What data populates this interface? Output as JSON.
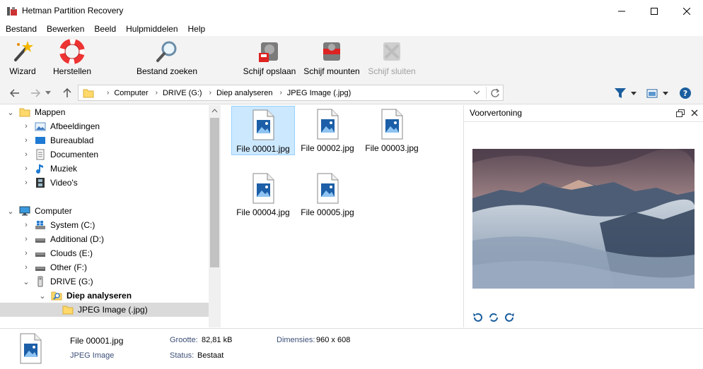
{
  "window": {
    "title": "Hetman Partition Recovery",
    "minimize_icon": "minimize-icon",
    "maximize_icon": "maximize-icon",
    "close_icon": "close-icon"
  },
  "menu": [
    "Bestand",
    "Bewerken",
    "Beeld",
    "Hulpmiddelen",
    "Help"
  ],
  "toolbar": {
    "wizard": "Wizard",
    "restore": "Herstellen",
    "find_file": "Bestand zoeken",
    "save_disk": "Schijf opslaan",
    "mount_disk": "Schijf mounten",
    "close_disk": "Schijf sluiten"
  },
  "address": {
    "crumbs": [
      "Computer",
      "DRIVE (G:)",
      "Diep analyseren",
      "JPEG Image (.jpg)"
    ]
  },
  "tree": {
    "folders_label": "Mappen",
    "folders": [
      "Afbeeldingen",
      "Bureaublad",
      "Documenten",
      "Muziek",
      "Video's"
    ],
    "computer_label": "Computer",
    "drives": [
      "System (C:)",
      "Additional (D:)",
      "Clouds (E:)",
      "Other (F:)",
      "DRIVE (G:)"
    ],
    "deep_scan": "Diep analyseren",
    "jpeg_folder": "JPEG Image (.jpg)"
  },
  "files": [
    "File 00001.jpg",
    "File 00002.jpg",
    "File 00003.jpg",
    "File 00004.jpg",
    "File 00005.jpg"
  ],
  "preview": {
    "title": "Voorvertoning"
  },
  "status": {
    "file_name": "File 00001.jpg",
    "file_type": "JPEG Image",
    "size_label": "Grootte:",
    "size_value": "82,81 kB",
    "status_label": "Status:",
    "status_value": "Bestaat",
    "dims_label": "Dimensies:",
    "dims_value": "960 x 608"
  }
}
